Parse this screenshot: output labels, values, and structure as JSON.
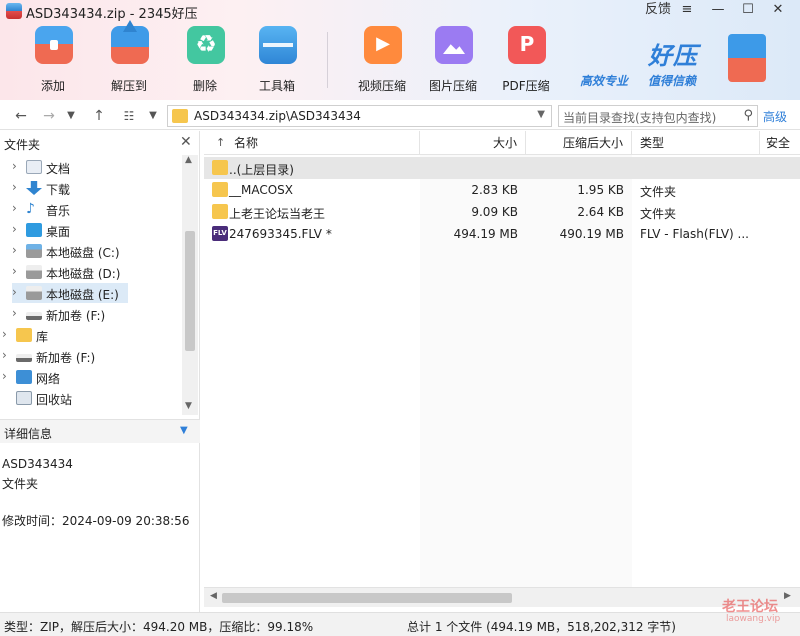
{
  "window": {
    "title": "ASD343434.zip - 2345好压",
    "feedback": "反馈",
    "menu_icon": "hamburger-icon",
    "minimize": "—",
    "maximize": "☐",
    "close": "✕"
  },
  "toolbar": {
    "add": "添加",
    "extract": "解压到",
    "delete": "删除",
    "tools": "工具箱",
    "video": "视频压缩",
    "image": "图片压缩",
    "pdf": "PDF压缩"
  },
  "brand": {
    "name": "好压",
    "slogan1": "高效专业",
    "slogan2": "值得信赖",
    "color": "#2f7fd8"
  },
  "address": {
    "path": "ASD343434.zip\\ASD343434",
    "search_placeholder": "当前目录查找(支持包内查找)",
    "advanced": "高级"
  },
  "left": {
    "title": "文件夹",
    "tree": [
      {
        "label": "文档",
        "icon": "document-icon"
      },
      {
        "label": "下载",
        "icon": "download-icon"
      },
      {
        "label": "音乐",
        "icon": "music-icon"
      },
      {
        "label": "桌面",
        "icon": "desktop-icon"
      },
      {
        "label": "本地磁盘 (C:)",
        "icon": "drive-icon"
      },
      {
        "label": "本地磁盘 (D:)",
        "icon": "drive-icon"
      },
      {
        "label": "本地磁盘 (E:)",
        "icon": "drive-icon"
      },
      {
        "label": "新加卷 (F:)",
        "icon": "drive-icon"
      },
      {
        "label": "库",
        "icon": "library-icon"
      },
      {
        "label": "新加卷 (F:)",
        "icon": "drive-icon"
      },
      {
        "label": "网络",
        "icon": "network-icon"
      },
      {
        "label": "回收站",
        "icon": "recycle-bin-icon"
      }
    ],
    "details_title": "详细信息",
    "details": {
      "name": "ASD343434",
      "kind": "文件夹",
      "modified": "修改时间：2024-09-09 20:38:56"
    }
  },
  "list": {
    "headers": {
      "name": "名称",
      "size": "大小",
      "csize": "压缩后大小",
      "type": "类型",
      "security": "安全"
    },
    "rows": [
      {
        "name": "..(上层目录)",
        "size": "",
        "csize": "",
        "type": "",
        "icon": "folder-icon"
      },
      {
        "name": "__MACOSX",
        "size": "2.83 KB",
        "csize": "1.95 KB",
        "type": "文件夹",
        "icon": "folder-icon"
      },
      {
        "name": "上老王论坛当老王",
        "size": "9.09 KB",
        "csize": "2.64 KB",
        "type": "文件夹",
        "icon": "folder-icon"
      },
      {
        "name": "247693345.FLV *",
        "size": "494.19 MB",
        "csize": "490.19 MB",
        "type": "FLV - Flash(FLV) ...",
        "icon": "flv-file-icon",
        "badge": "FLV"
      }
    ]
  },
  "status": {
    "left": "类型：ZIP，解压后大小：494.20 MB，压缩比：99.18%",
    "right": "总计 1 个文件 (494.19 MB，518,202,312 字节)"
  },
  "watermark": {
    "text": "老王论坛",
    "url": "laowang.vip"
  }
}
